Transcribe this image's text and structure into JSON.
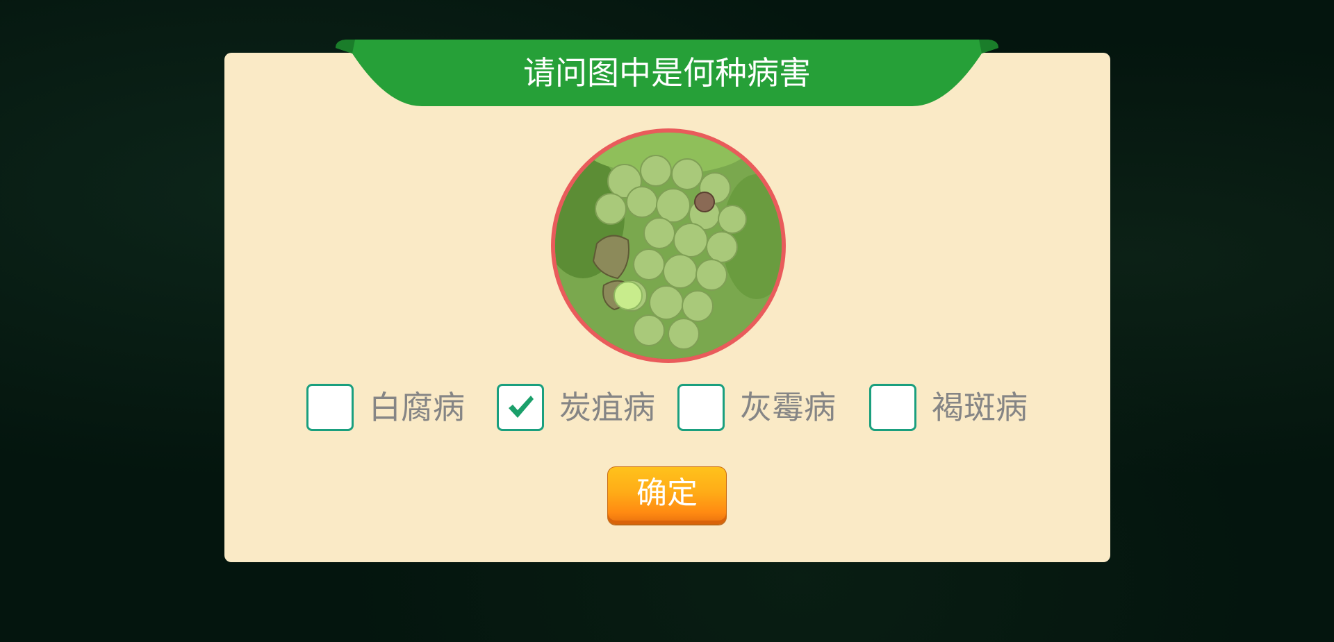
{
  "dialog": {
    "title": "请问图中是何种病害"
  },
  "photo": {
    "subject": "grape-cluster-photo"
  },
  "options": [
    {
      "label": "白腐病",
      "checked": false
    },
    {
      "label": "炭疽病",
      "checked": true
    },
    {
      "label": "灰霉病",
      "checked": false
    },
    {
      "label": "褐斑病",
      "checked": false
    }
  ],
  "confirm": {
    "label": "确定"
  },
  "colors": {
    "banner": "#26a038",
    "panel": "#faeac6",
    "checkbox_border": "#1a9f7e",
    "checkmark": "#1a9f6a",
    "photo_ring": "#e95b5b",
    "button": "#ffab17",
    "label_text": "#858585"
  }
}
